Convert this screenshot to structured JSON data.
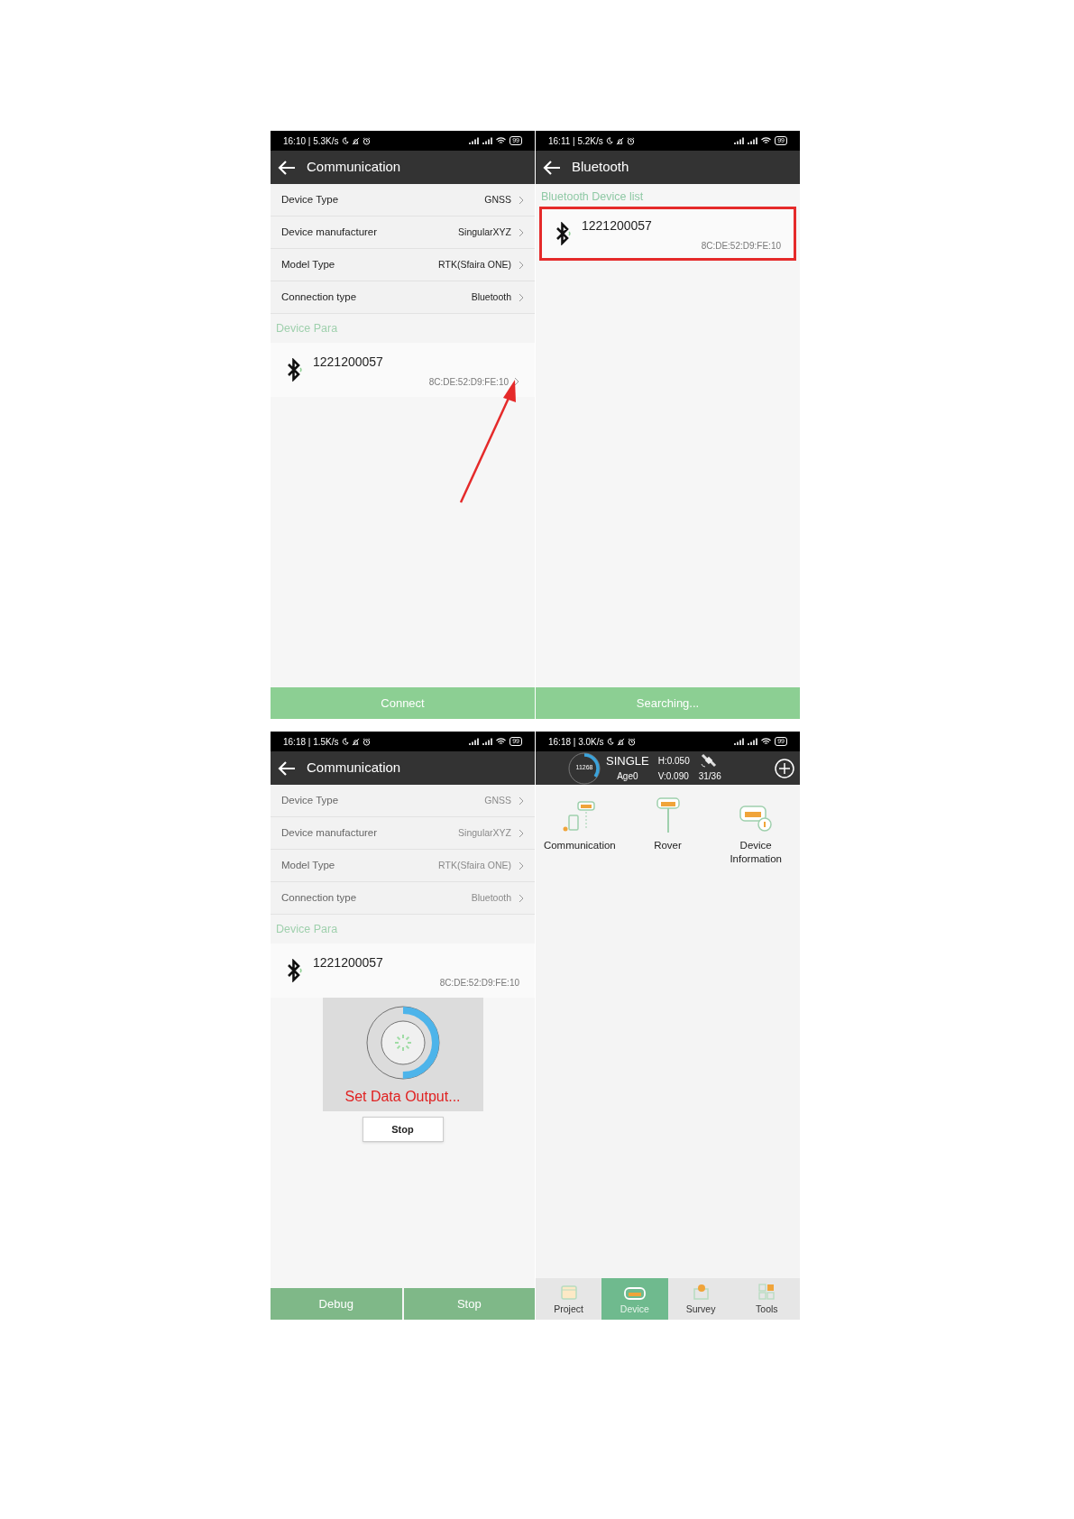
{
  "screens": [
    {
      "kind": "communication",
      "status_bar": {
        "text": "16:10 | 5.3K/s",
        "battery": "99"
      },
      "header": {
        "title": "Communication"
      },
      "settings": [
        {
          "label": "Device Type",
          "value": "GNSS",
          "disabled": false
        },
        {
          "label": "Device manufacturer",
          "value": "SingularXYZ",
          "disabled": false
        },
        {
          "label": "Model Type",
          "value": "RTK(Sfaira ONE)",
          "disabled": false
        },
        {
          "label": "Connection type",
          "value": "Bluetooth",
          "disabled": false
        }
      ],
      "section_title": "Device Para",
      "device": {
        "name": "1221200057",
        "address": "8C:DE:52:D9:FE:10",
        "highlighted": false,
        "chevron": true
      },
      "pointer_arrow": true,
      "buttons": [
        {
          "label": "Connect",
          "faded": false
        }
      ]
    },
    {
      "kind": "bluetooth",
      "status_bar": {
        "text": "16:11 | 5.2K/s",
        "battery": "99"
      },
      "header": {
        "title": "Bluetooth"
      },
      "section_title": "Bluetooth Device list",
      "device": {
        "name": "1221200057",
        "address": "8C:DE:52:D9:FE:10",
        "highlighted": true,
        "chevron": false
      },
      "buttons": [
        {
          "label": "Searching...",
          "faded": false
        }
      ]
    },
    {
      "kind": "communication",
      "status_bar": {
        "text": "16:18 | 1.5K/s",
        "battery": "99"
      },
      "header": {
        "title": "Communication"
      },
      "settings": [
        {
          "label": "Device Type",
          "value": "GNSS",
          "disabled": true
        },
        {
          "label": "Device manufacturer",
          "value": "SingularXYZ",
          "disabled": true
        },
        {
          "label": "Model Type",
          "value": "RTK(Sfaira ONE)",
          "disabled": true
        },
        {
          "label": "Connection type",
          "value": "Bluetooth",
          "disabled": true
        }
      ],
      "section_title": "Device Para",
      "device": {
        "name": "1221200057",
        "address": "8C:DE:52:D9:FE:10",
        "highlighted": false,
        "chevron": false
      },
      "dialog": {
        "level": 0.5,
        "message": "Set Data Output...",
        "button": "Stop"
      },
      "buttons": [
        {
          "label": "Debug",
          "faded": true
        },
        {
          "label": "Stop",
          "faded": true
        }
      ]
    },
    {
      "kind": "home",
      "status_bar": {
        "text": "16:18 | 3.0K/s",
        "battery": "99"
      },
      "gnss": {
        "count": "11268",
        "level": 0.35,
        "mode": "SINGLE",
        "age": "Age0",
        "h": "H:0.050",
        "v": "V:0.090",
        "satellites": "31/36"
      },
      "menu": [
        {
          "kind": "communication",
          "label": "Communication"
        },
        {
          "kind": "rover",
          "label": "Rover"
        },
        {
          "kind": "info",
          "label": "Device Information"
        }
      ],
      "tabs": [
        {
          "kind": "project",
          "label": "Project",
          "selected": false
        },
        {
          "kind": "device",
          "label": "Device",
          "selected": true
        },
        {
          "kind": "survey",
          "label": "Survey",
          "selected": false
        },
        {
          "kind": "tools",
          "label": "Tools",
          "selected": false
        }
      ]
    }
  ]
}
